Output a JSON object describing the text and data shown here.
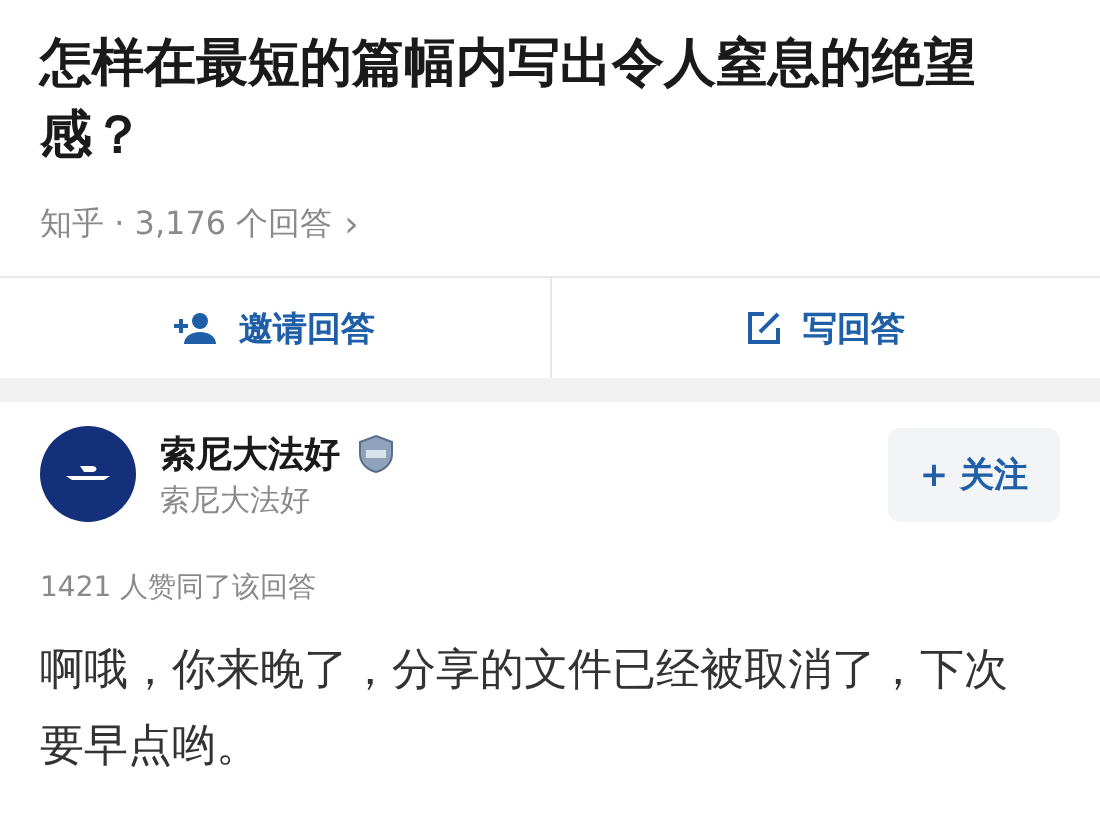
{
  "question": {
    "title": "怎样在最短的篇幅内写出令人窒息的绝望感？",
    "meta": "知乎 · 3,176 个回答",
    "chevron": "›"
  },
  "actions": [
    {
      "kind": "invite",
      "label": "邀请回答"
    },
    {
      "kind": "write",
      "label": "写回答"
    }
  ],
  "answer": {
    "author": "索尼大法好",
    "subtitle": "索尼大法好",
    "follow": "+ 关注",
    "votes": "1421 人赞同了该回答",
    "body": "啊哦，你来晚了，分享的文件已经被取消了，下次要早点哟。"
  }
}
